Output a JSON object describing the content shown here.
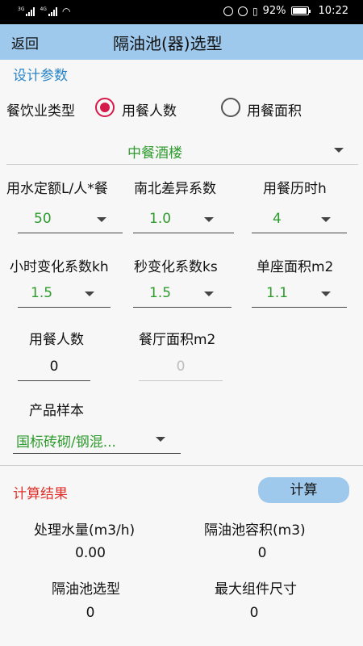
{
  "status_bar": {
    "signal1": "3G",
    "signal2": "4G",
    "battery_percent": "92%",
    "time": "10:22"
  },
  "header": {
    "back_label": "返回",
    "title": "隔油池(器)选型"
  },
  "design_params": {
    "section_title": "设计参数",
    "catering_type_label": "餐饮业类型",
    "radio_options": [
      "用餐人数",
      "用餐面积"
    ],
    "radio_selected": 0,
    "restaurant_type": "中餐酒楼",
    "water_quota_label": "用水定额L/人*餐",
    "water_quota_value": "50",
    "ns_coeff_label": "南北差异系数",
    "ns_coeff_value": "1.0",
    "dining_hours_label": "用餐历时h",
    "dining_hours_value": "4",
    "hourly_coeff_label": "小时变化系数kh",
    "hourly_coeff_value": "1.5",
    "second_coeff_label": "秒变化系数ks",
    "second_coeff_value": "1.5",
    "seat_area_label": "单座面积m2",
    "seat_area_value": "1.1",
    "diners_label": "用餐人数",
    "diners_value": "0",
    "hall_area_label": "餐厅面积m2",
    "hall_area_value": "0",
    "product_label": "产品样本",
    "product_value": "国标砖砌/钢混..."
  },
  "results": {
    "section_title": "计算结果",
    "calc_button": "计算",
    "flow_label": "处理水量(m3/h)",
    "flow_value": "0.00",
    "volume_label": "隔油池容积(m3)",
    "volume_value": "0",
    "model_label": "隔油池选型",
    "model_value": "0",
    "max_size_label": "最大组件尺寸",
    "max_size_value": "0"
  },
  "colors": {
    "accent_blue": "#2a86c8",
    "appbar": "#9ec8ec",
    "radio_selected": "#d51a4a",
    "value_green": "#2e9b2e",
    "result_red": "#e0302a"
  }
}
